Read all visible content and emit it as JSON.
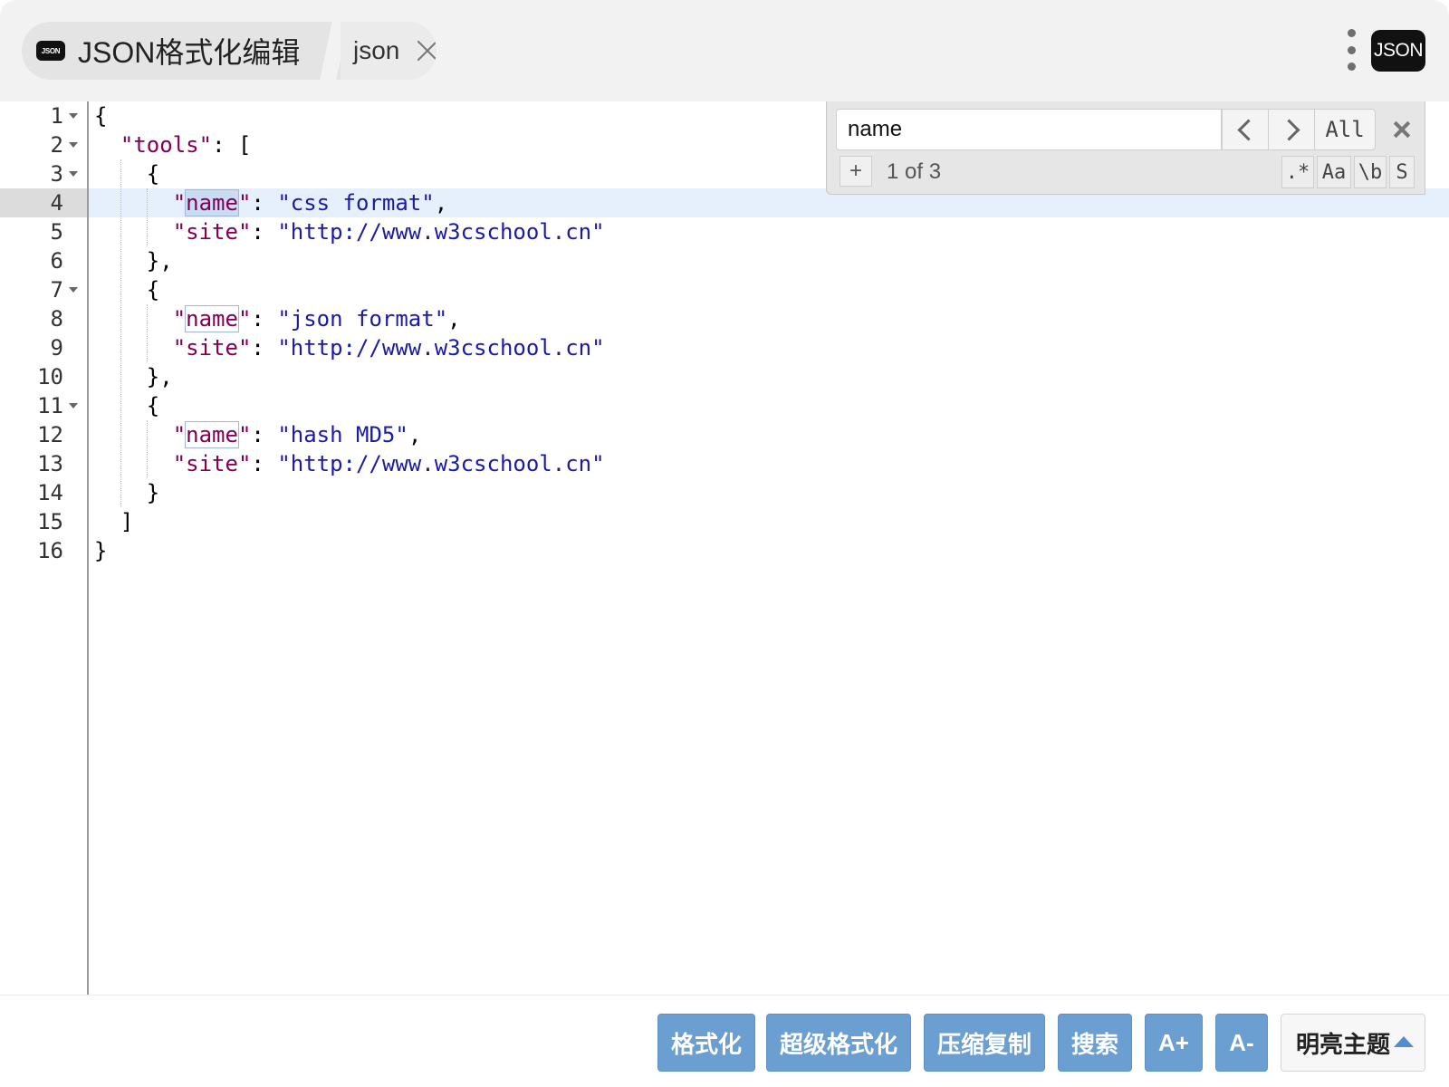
{
  "header": {
    "app_logo_text": "JSON",
    "app_title": "JSON格式化编辑",
    "tab_label": "json",
    "app_icon_text": "JSON"
  },
  "editor": {
    "line_numbers": [
      "1",
      "2",
      "3",
      "4",
      "5",
      "6",
      "7",
      "8",
      "9",
      "10",
      "11",
      "12",
      "13",
      "14",
      "15",
      "16"
    ],
    "active_line": 4,
    "lines": [
      "{",
      "  \"tools\": [",
      "    {",
      "      \"name\": \"css format\",",
      "      \"site\": \"http://www.w3cschool.cn\"",
      "    },",
      "    {",
      "      \"name\": \"json format\",",
      "      \"site\": \"http://www.w3cschool.cn\"",
      "    },",
      "    {",
      "      \"name\": \"hash MD5\",",
      "      \"site\": \"http://www.w3cschool.cn\"",
      "    }",
      "  ]",
      "}"
    ]
  },
  "search": {
    "query": "name",
    "all_label": "All",
    "replace_toggle": "+",
    "counter": "1 of 3",
    "options": [
      ".*",
      "Aa",
      "\\b",
      "S"
    ]
  },
  "footer": {
    "buttons": [
      "格式化",
      "超级格式化",
      "压缩复制",
      "搜索",
      "A+",
      "A-"
    ],
    "theme_label": "明亮主题"
  },
  "colors": {
    "button_blue": "#6c9fd1",
    "string_blue": "#1a1aa6",
    "key_purple": "#800055",
    "active_line": "#e6f0fc"
  }
}
